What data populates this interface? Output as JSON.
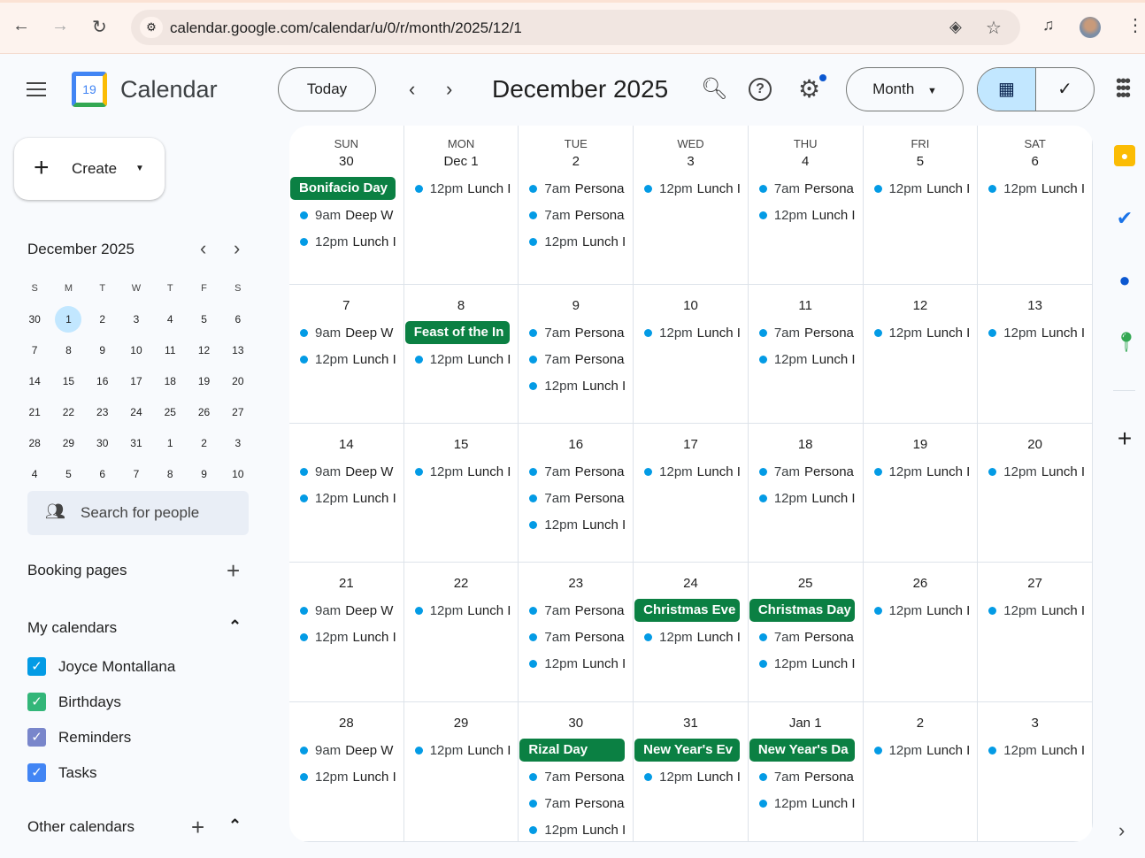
{
  "browser": {
    "url": "calendar.google.com/calendar/u/0/r/month/2025/12/1"
  },
  "header": {
    "app_name": "Calendar",
    "logo_day": "19",
    "today": "Today",
    "title": "December 2025",
    "view": "Month"
  },
  "sidebar": {
    "create": "Create",
    "mini_title": "December 2025",
    "weekday_initials": [
      "S",
      "M",
      "T",
      "W",
      "T",
      "F",
      "S"
    ],
    "mini_weeks": [
      [
        "30",
        "1",
        "2",
        "3",
        "4",
        "5",
        "6"
      ],
      [
        "7",
        "8",
        "9",
        "10",
        "11",
        "12",
        "13"
      ],
      [
        "14",
        "15",
        "16",
        "17",
        "18",
        "19",
        "20"
      ],
      [
        "21",
        "22",
        "23",
        "24",
        "25",
        "26",
        "27"
      ],
      [
        "28",
        "29",
        "30",
        "31",
        "1",
        "2",
        "3"
      ],
      [
        "4",
        "5",
        "6",
        "7",
        "8",
        "9",
        "10"
      ]
    ],
    "selected_day": "1",
    "search_people": "Search for people",
    "booking_pages": "Booking pages",
    "my_calendars": "My calendars",
    "calendars": [
      {
        "name": "Joyce Montallana",
        "color": "#039be5"
      },
      {
        "name": "Birthdays",
        "color": "#33b679"
      },
      {
        "name": "Reminders",
        "color": "#7986cb"
      },
      {
        "name": "Tasks",
        "color": "#4285f4"
      }
    ],
    "other_calendars": "Other calendars"
  },
  "grid": {
    "weekdays": [
      "SUN",
      "MON",
      "TUE",
      "WED",
      "THU",
      "FRI",
      "SAT"
    ],
    "weeks": [
      [
        {
          "d": "30",
          "ev": [
            {
              "chip": "Bonifacio Day"
            },
            {
              "t": "9am",
              "n": "Deep W"
            },
            {
              "t": "12pm",
              "n": "Lunch I"
            }
          ]
        },
        {
          "d": "Dec 1",
          "ev": [
            {
              "t": "12pm",
              "n": "Lunch I"
            }
          ]
        },
        {
          "d": "2",
          "ev": [
            {
              "t": "7am",
              "n": "Persona"
            },
            {
              "t": "7am",
              "n": "Persona"
            },
            {
              "t": "12pm",
              "n": "Lunch I"
            }
          ]
        },
        {
          "d": "3",
          "ev": [
            {
              "t": "12pm",
              "n": "Lunch I"
            }
          ]
        },
        {
          "d": "4",
          "ev": [
            {
              "t": "7am",
              "n": "Persona"
            },
            {
              "t": "12pm",
              "n": "Lunch I"
            }
          ]
        },
        {
          "d": "5",
          "ev": [
            {
              "t": "12pm",
              "n": "Lunch I"
            }
          ]
        },
        {
          "d": "6",
          "ev": [
            {
              "t": "12pm",
              "n": "Lunch I"
            }
          ]
        }
      ],
      [
        {
          "d": "7",
          "ev": [
            {
              "t": "9am",
              "n": "Deep W"
            },
            {
              "t": "12pm",
              "n": "Lunch I"
            }
          ]
        },
        {
          "d": "8",
          "ev": [
            {
              "chip": "Feast of the In"
            },
            {
              "t": "12pm",
              "n": "Lunch I"
            }
          ]
        },
        {
          "d": "9",
          "ev": [
            {
              "t": "7am",
              "n": "Persona"
            },
            {
              "t": "7am",
              "n": "Persona"
            },
            {
              "t": "12pm",
              "n": "Lunch I"
            }
          ]
        },
        {
          "d": "10",
          "ev": [
            {
              "t": "12pm",
              "n": "Lunch I"
            }
          ]
        },
        {
          "d": "11",
          "ev": [
            {
              "t": "7am",
              "n": "Persona"
            },
            {
              "t": "12pm",
              "n": "Lunch I"
            }
          ]
        },
        {
          "d": "12",
          "ev": [
            {
              "t": "12pm",
              "n": "Lunch I"
            }
          ]
        },
        {
          "d": "13",
          "ev": [
            {
              "t": "12pm",
              "n": "Lunch I"
            }
          ]
        }
      ],
      [
        {
          "d": "14",
          "ev": [
            {
              "t": "9am",
              "n": "Deep W"
            },
            {
              "t": "12pm",
              "n": "Lunch I"
            }
          ]
        },
        {
          "d": "15",
          "ev": [
            {
              "t": "12pm",
              "n": "Lunch I"
            }
          ]
        },
        {
          "d": "16",
          "ev": [
            {
              "t": "7am",
              "n": "Persona"
            },
            {
              "t": "7am",
              "n": "Persona"
            },
            {
              "t": "12pm",
              "n": "Lunch I"
            }
          ]
        },
        {
          "d": "17",
          "ev": [
            {
              "t": "12pm",
              "n": "Lunch I"
            }
          ]
        },
        {
          "d": "18",
          "ev": [
            {
              "t": "7am",
              "n": "Persona"
            },
            {
              "t": "12pm",
              "n": "Lunch I"
            }
          ]
        },
        {
          "d": "19",
          "ev": [
            {
              "t": "12pm",
              "n": "Lunch I"
            }
          ]
        },
        {
          "d": "20",
          "ev": [
            {
              "t": "12pm",
              "n": "Lunch I"
            }
          ]
        }
      ],
      [
        {
          "d": "21",
          "ev": [
            {
              "t": "9am",
              "n": "Deep W"
            },
            {
              "t": "12pm",
              "n": "Lunch I"
            }
          ]
        },
        {
          "d": "22",
          "ev": [
            {
              "t": "12pm",
              "n": "Lunch I"
            }
          ]
        },
        {
          "d": "23",
          "ev": [
            {
              "t": "7am",
              "n": "Persona"
            },
            {
              "t": "7am",
              "n": "Persona"
            },
            {
              "t": "12pm",
              "n": "Lunch I"
            }
          ]
        },
        {
          "d": "24",
          "ev": [
            {
              "chip": "Christmas Eve"
            },
            {
              "t": "12pm",
              "n": "Lunch I"
            }
          ]
        },
        {
          "d": "25",
          "ev": [
            {
              "chip": "Christmas Day"
            },
            {
              "t": "7am",
              "n": "Persona"
            },
            {
              "t": "12pm",
              "n": "Lunch I"
            }
          ]
        },
        {
          "d": "26",
          "ev": [
            {
              "t": "12pm",
              "n": "Lunch I"
            }
          ]
        },
        {
          "d": "27",
          "ev": [
            {
              "t": "12pm",
              "n": "Lunch I"
            }
          ]
        }
      ],
      [
        {
          "d": "28",
          "ev": [
            {
              "t": "9am",
              "n": "Deep W"
            },
            {
              "t": "12pm",
              "n": "Lunch I"
            }
          ]
        },
        {
          "d": "29",
          "ev": [
            {
              "t": "12pm",
              "n": "Lunch I"
            }
          ]
        },
        {
          "d": "30",
          "ev": [
            {
              "chip": "Rizal Day"
            },
            {
              "t": "7am",
              "n": "Persona"
            },
            {
              "t": "7am",
              "n": "Persona"
            },
            {
              "t": "12pm",
              "n": "Lunch I"
            }
          ]
        },
        {
          "d": "31",
          "ev": [
            {
              "chip": "New Year's Ev"
            },
            {
              "t": "12pm",
              "n": "Lunch I"
            }
          ]
        },
        {
          "d": "Jan 1",
          "ev": [
            {
              "chip": "New Year's Da"
            },
            {
              "t": "7am",
              "n": "Persona"
            },
            {
              "t": "12pm",
              "n": "Lunch I"
            }
          ]
        },
        {
          "d": "2",
          "ev": [
            {
              "t": "12pm",
              "n": "Lunch I"
            }
          ]
        },
        {
          "d": "3",
          "ev": [
            {
              "t": "12pm",
              "n": "Lunch I"
            }
          ]
        }
      ]
    ]
  },
  "colors": {
    "accent": "#c2e7ff",
    "event_dot": "#039be5",
    "holiday": "#0b8043"
  }
}
